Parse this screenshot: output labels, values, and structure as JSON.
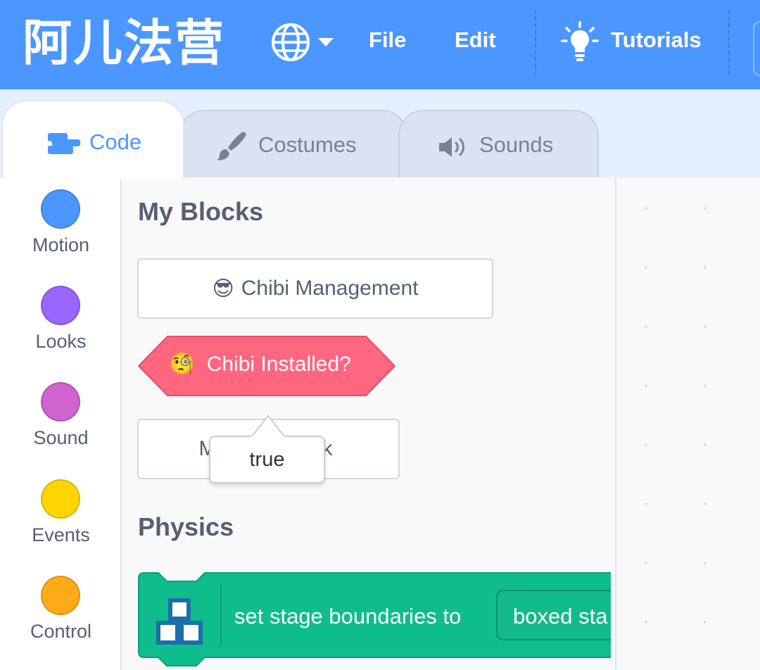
{
  "menubar": {
    "logo_text": "阿儿法营",
    "file_label": "File",
    "edit_label": "Edit",
    "tutorials_label": "Tutorials",
    "accent_color": "#4c97ff"
  },
  "tabs": [
    {
      "label": "Code",
      "icon": "code-icon",
      "active": true
    },
    {
      "label": "Costumes",
      "icon": "paintbrush-icon",
      "active": false
    },
    {
      "label": "Sounds",
      "icon": "speaker-icon",
      "active": false
    }
  ],
  "categories": [
    {
      "label": "Motion",
      "color": "#4c97ff"
    },
    {
      "label": "Looks",
      "color": "#9966ff"
    },
    {
      "label": "Sound",
      "color": "#cf63cf"
    },
    {
      "label": "Events",
      "color": "#ffd500"
    },
    {
      "label": "Control",
      "color": "#ffab19"
    }
  ],
  "palette": {
    "my_blocks_title": "My Blocks",
    "chibi_management_emoji": "😎",
    "chibi_management_label": "Chibi Management",
    "chibi_installed_emoji": "🧐",
    "chibi_installed_label": "Chibi Installed?",
    "hidden_button_label_left": "M",
    "hidden_button_label_right": "k",
    "tooltip_value": "true",
    "physics_title": "Physics",
    "physics_block_label": "set stage boundaries to",
    "physics_block_value": "boxed sta",
    "reporter_color": "#ff6680",
    "physics_color": "#0fbd8c"
  }
}
